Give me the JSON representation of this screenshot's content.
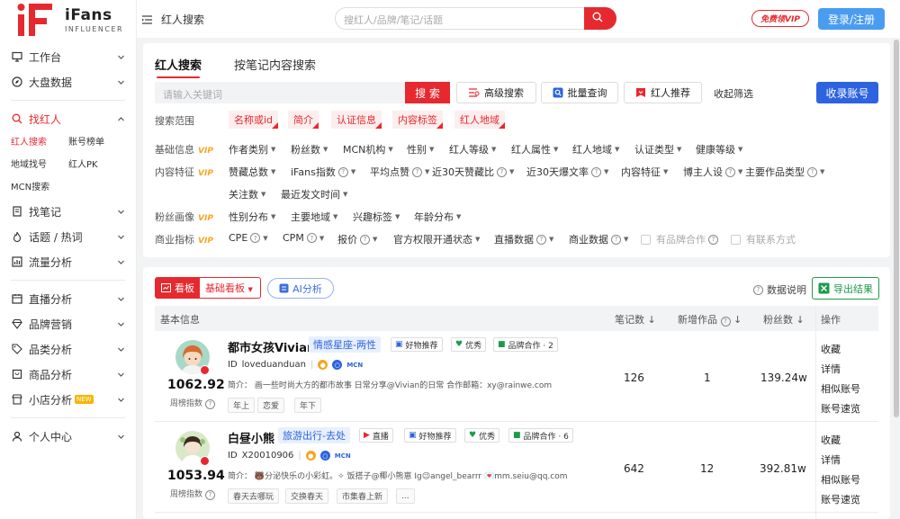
{
  "brand": {
    "name": "iFans",
    "sub": "INFLUENCER",
    "accent": "#e6292f"
  },
  "sidebar": {
    "items": [
      {
        "label": "工作台",
        "icon": "desktop-icon"
      },
      {
        "label": "大盘数据",
        "icon": "compass-icon"
      },
      {
        "label": "找红人",
        "icon": "search-icon",
        "active": true
      },
      {
        "label": "找笔记",
        "icon": "note-icon"
      },
      {
        "label": "话题 / 热词",
        "icon": "fire-icon"
      },
      {
        "label": "流量分析",
        "icon": "chart-icon"
      },
      {
        "label": "直播分析",
        "icon": "calendar-icon"
      },
      {
        "label": "品牌营销",
        "icon": "diamond-icon"
      },
      {
        "label": "品类分析",
        "icon": "tag-icon"
      },
      {
        "label": "商品分析",
        "icon": "bag-icon"
      },
      {
        "label": "小店分析",
        "icon": "shop-icon",
        "badge": "NEW"
      },
      {
        "label": "个人中心",
        "icon": "user-icon"
      }
    ],
    "sub": [
      "红人搜索",
      "账号榜单",
      "地域找号",
      "红人PK",
      "MCN搜索"
    ]
  },
  "topbar": {
    "crumb": "红人搜索",
    "search_placeholder": "搜红人/品牌/笔记/话题",
    "vip": "免费领VIP",
    "login": "登录/注册"
  },
  "search_panel": {
    "tabs": [
      "红人搜索",
      "按笔记内容搜索"
    ],
    "keyword_placeholder": "请输入关键词",
    "search_btn": "搜 索",
    "advanced": "高级搜索",
    "batch": "批量查询",
    "recommend": "红人推荐",
    "collapse": "收起筛选",
    "fav": "收录账号",
    "scope_label": "搜索范围",
    "scopes": [
      "名称或id",
      "简介",
      "认证信息",
      "内容标签",
      "红人地域"
    ],
    "vip_tag": "VIP",
    "rows": [
      {
        "label": "基础信息",
        "filters": [
          "作者类别",
          "粉丝数",
          "MCN机构",
          "性别",
          "红人等级",
          "红人属性",
          "红人地域",
          "认证类型",
          "健康等级"
        ]
      },
      {
        "label": "内容特征",
        "filters": [
          "赞藏总数",
          "iFans指数",
          "平均点赞",
          "近30天赞藏比",
          "近30天爆文率",
          "内容特征",
          "博主人设",
          "主要作品类型"
        ],
        "filters2": [
          "关注数",
          "最近发文时间"
        ]
      },
      {
        "label": "粉丝画像",
        "filters": [
          "性别分布",
          "主要地域",
          "兴趣标签",
          "年龄分布"
        ]
      },
      {
        "label": "商业指标",
        "filters": [
          "CPE",
          "CPM",
          "报价",
          "官方权限开通状态",
          "直播数据",
          "商业数据"
        ],
        "checks": [
          "有品牌合作",
          "有联系方式"
        ]
      }
    ]
  },
  "result_panel": {
    "kanban": "看板",
    "kanban_select": "基础看板",
    "ai": "AI分析",
    "data_explain": "数据说明",
    "export": "导出结果",
    "headers": [
      "基本信息",
      "笔记数",
      "新增作品",
      "粉丝数",
      "操作"
    ],
    "rows": [
      {
        "name": "都市女孩Vivian",
        "category": "情感星座-两性",
        "badges": [
          "好物推荐",
          "优秀",
          "品牌合作 · 2"
        ],
        "id_label": "ID",
        "id": "loveduanduan",
        "mcn": "MCN",
        "intro": "简介：  画一些时尚大方的都市故事 日常分享@Vivian的日常 合作邮箱：xy@rainwe.com",
        "tags": [
          "年上",
          "恋爱",
          "年下"
        ],
        "score": "1062.92",
        "score_label": "周榜指数",
        "notes": "126",
        "new_works": "1",
        "fans": "139.24w",
        "ops": [
          "收藏",
          "详情",
          "相似账号",
          "账号速览"
        ]
      },
      {
        "name": "白昼小熊",
        "category": "旅游出行-去处",
        "badges": [
          "直播",
          "好物推荐",
          "优秀",
          "品牌合作 · 6"
        ],
        "id_label": "ID",
        "id": "X20010906",
        "mcn": "MCN",
        "intro": "简介：  🐻分泌快乐の小彩虹。✧ 饭搭子@椰小熊崽 Ig😉angel_bearrr 💌mm.seiu@qq.com",
        "tags": [
          "春天去哪玩",
          "交换春天",
          "市集春上新",
          "..."
        ],
        "score": "1053.94",
        "score_label": "周榜指数",
        "notes": "642",
        "new_works": "12",
        "fans": "392.81w",
        "ops": [
          "收藏",
          "详情",
          "相似账号",
          "账号速览"
        ]
      }
    ]
  }
}
